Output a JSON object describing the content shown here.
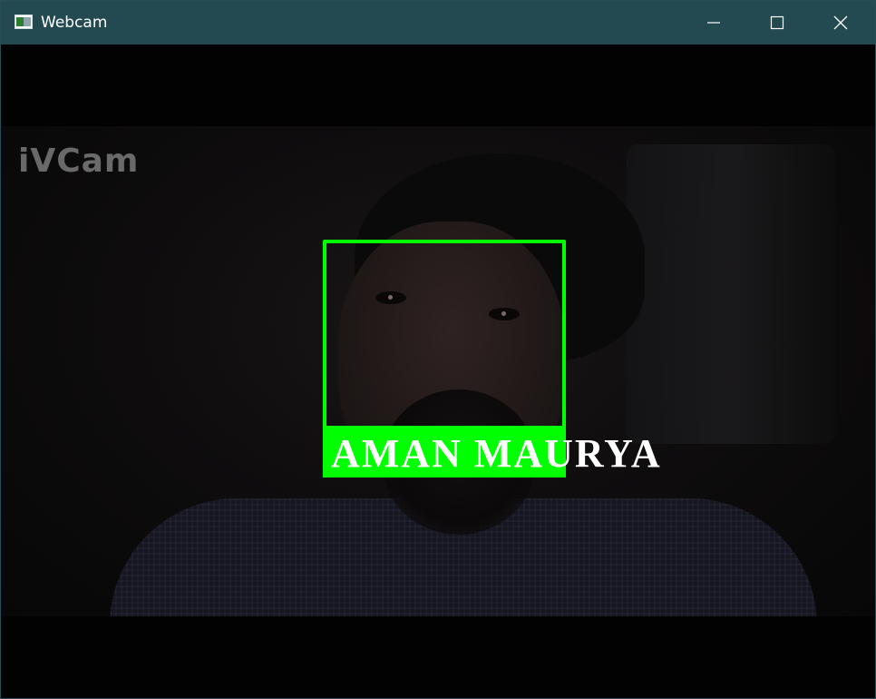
{
  "window": {
    "title": "Webcam",
    "controls": {
      "minimize_icon": "minimize-icon",
      "maximize_icon": "maximize-icon",
      "close_icon": "close-icon"
    }
  },
  "video": {
    "watermark": "iVCam",
    "detection": {
      "label": "AMAN MAURYA",
      "box_color": "#00ff00",
      "label_color": "#ffffff"
    }
  },
  "colors": {
    "titlebar": "#244a51",
    "titlebar_text": "#ffffff"
  }
}
